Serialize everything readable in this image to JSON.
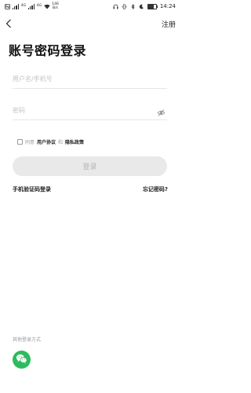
{
  "status_bar": {
    "network_speed_value": "146",
    "network_speed_unit": "B/s",
    "time": "14:24",
    "sim_labels": [
      "4G",
      "4G"
    ],
    "battery_level": 0.7,
    "icons": [
      "nfc-icon",
      "signal-icon",
      "wifi-icon",
      "headphones-icon",
      "vibrate-icon",
      "bluetooth-icon",
      "dnd-icon",
      "battery-icon"
    ]
  },
  "header": {
    "back_icon": "chevron-left-icon",
    "register_label": "注册"
  },
  "page": {
    "title": "账号密码登录"
  },
  "form": {
    "username_placeholder": "用户名/手机号",
    "username_value": "",
    "password_placeholder": "密码",
    "password_value": "",
    "password_toggle_icon": "eye-hidden-icon"
  },
  "agreement": {
    "prefix": "同意",
    "user_agreement": "用户协议",
    "conjunction": "和",
    "privacy_policy": "隐私政策",
    "checked": false
  },
  "login_button_label": "登录",
  "links": {
    "sms_login": "手机验证码登录",
    "forgot_password": "忘记密码?"
  },
  "other_login": {
    "label": "其他登录方式",
    "wechat_icon": "wechat-icon",
    "wechat_color": "#2dbb5f"
  }
}
